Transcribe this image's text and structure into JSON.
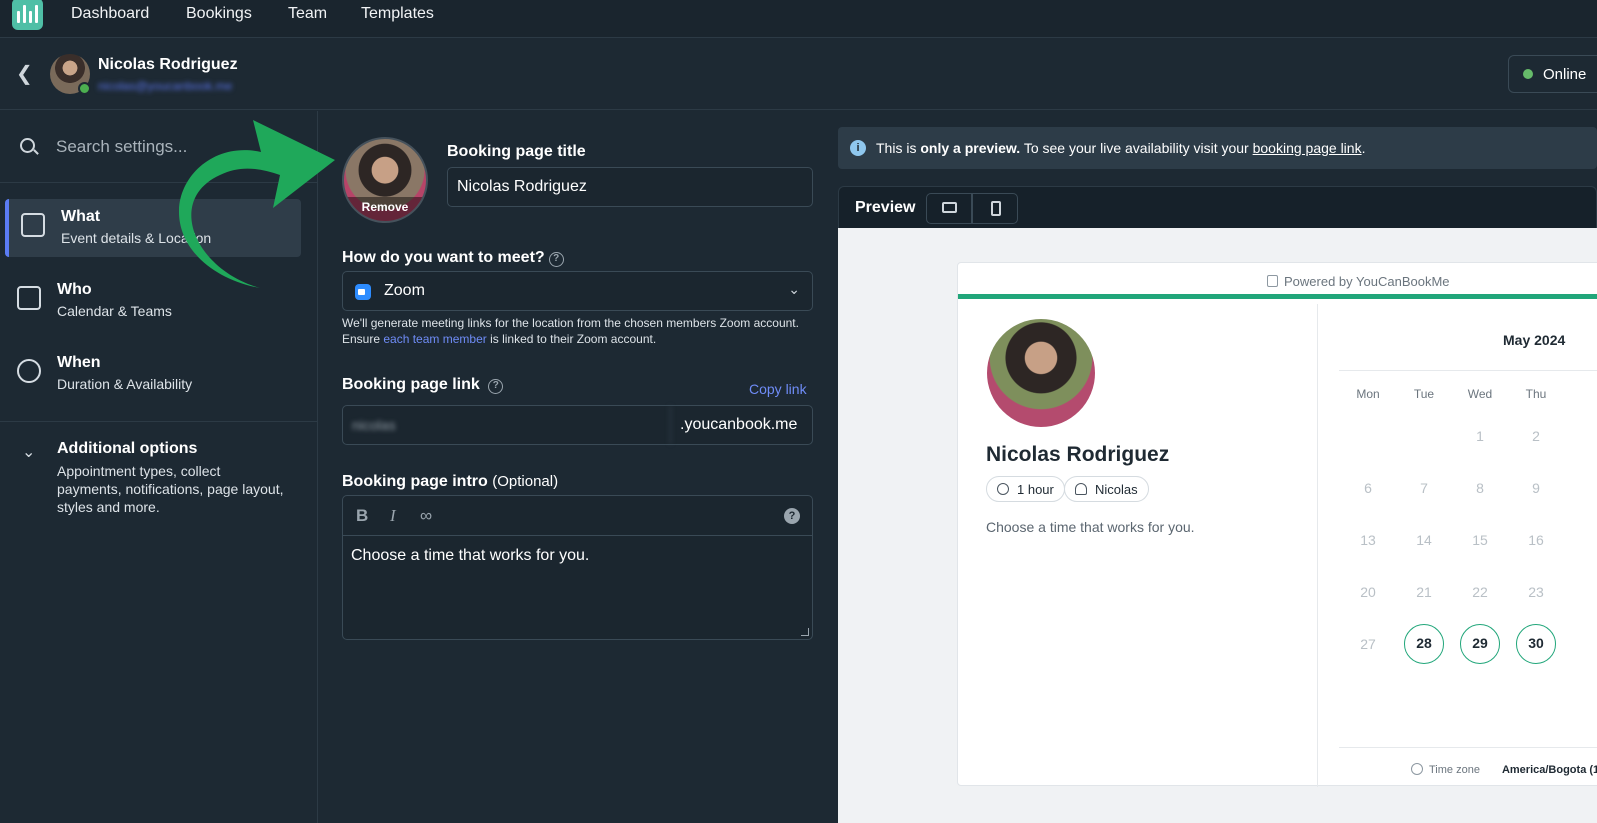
{
  "nav": {
    "items": [
      "Dashboard",
      "Bookings",
      "Team",
      "Templates"
    ]
  },
  "user": {
    "name": "Nicolas Rodriguez",
    "email": "nicolas@youcanbook.me",
    "status": "Online"
  },
  "sidebar": {
    "search_placeholder": "Search settings...",
    "items": [
      {
        "title": "What",
        "subtitle": "Event details & Location"
      },
      {
        "title": "Who",
        "subtitle": "Calendar & Teams"
      },
      {
        "title": "When",
        "subtitle": "Duration & Availability"
      }
    ],
    "additional": {
      "title": "Additional options",
      "subtitle": "Appointment types, collect payments, notifications, page layout, styles and more."
    }
  },
  "form": {
    "photo_remove": "Remove",
    "title_label": "Booking page title",
    "title_value": "Nicolas Rodriguez",
    "meet_label": "How do you want to meet?",
    "meet_value": "Zoom",
    "meet_help_1": "We'll generate meeting links for the location from the chosen members Zoom account. Ensure ",
    "meet_help_link": "each team member",
    "meet_help_2": " is linked to their Zoom account.",
    "link_label": "Booking page link",
    "copy_link": "Copy link",
    "link_value": "nicolas",
    "link_suffix": ".youcanbook.me",
    "intro_label": "Booking page intro",
    "intro_optional": "(Optional)",
    "intro_value": "Choose a time that works for you."
  },
  "preview": {
    "notice_pre": "This is ",
    "notice_bold": "only a preview.",
    "notice_mid": " To see your live availability visit your ",
    "notice_link": "booking page link",
    "notice_end": ".",
    "label": "Preview",
    "powered": "Powered by YouCanBookMe",
    "name": "Nicolas Rodriguez",
    "duration": "1 hour",
    "host": "Nicolas",
    "intro": "Choose a time that works for you.",
    "month": "May 2024",
    "weekdays": [
      "Mon",
      "Tue",
      "Wed",
      "Thu"
    ],
    "weeks": [
      [
        "",
        "",
        "1",
        "2"
      ],
      [
        "6",
        "7",
        "8",
        "9"
      ],
      [
        "13",
        "14",
        "15",
        "16"
      ],
      [
        "20",
        "21",
        "22",
        "23"
      ],
      [
        "27",
        "28",
        "29",
        "30"
      ]
    ],
    "available": [
      "28",
      "29",
      "30"
    ],
    "tz_label": "Time zone",
    "tz_value": "America/Bogota (1"
  },
  "colors": {
    "accent": "#21a67a",
    "link": "#6f8cf7",
    "active_bar": "#5b7cf4",
    "arrow": "#1fa85a"
  },
  "icons": [
    "app-logo-icon",
    "back-chevron-icon",
    "search-icon",
    "what-icon",
    "who-icon",
    "when-icon",
    "chevron-down-icon",
    "zoom-icon",
    "help-icon",
    "bold-icon",
    "italic-icon",
    "link-icon",
    "info-icon",
    "desktop-icon",
    "mobile-icon",
    "clock-icon",
    "person-icon",
    "globe-icon"
  ]
}
